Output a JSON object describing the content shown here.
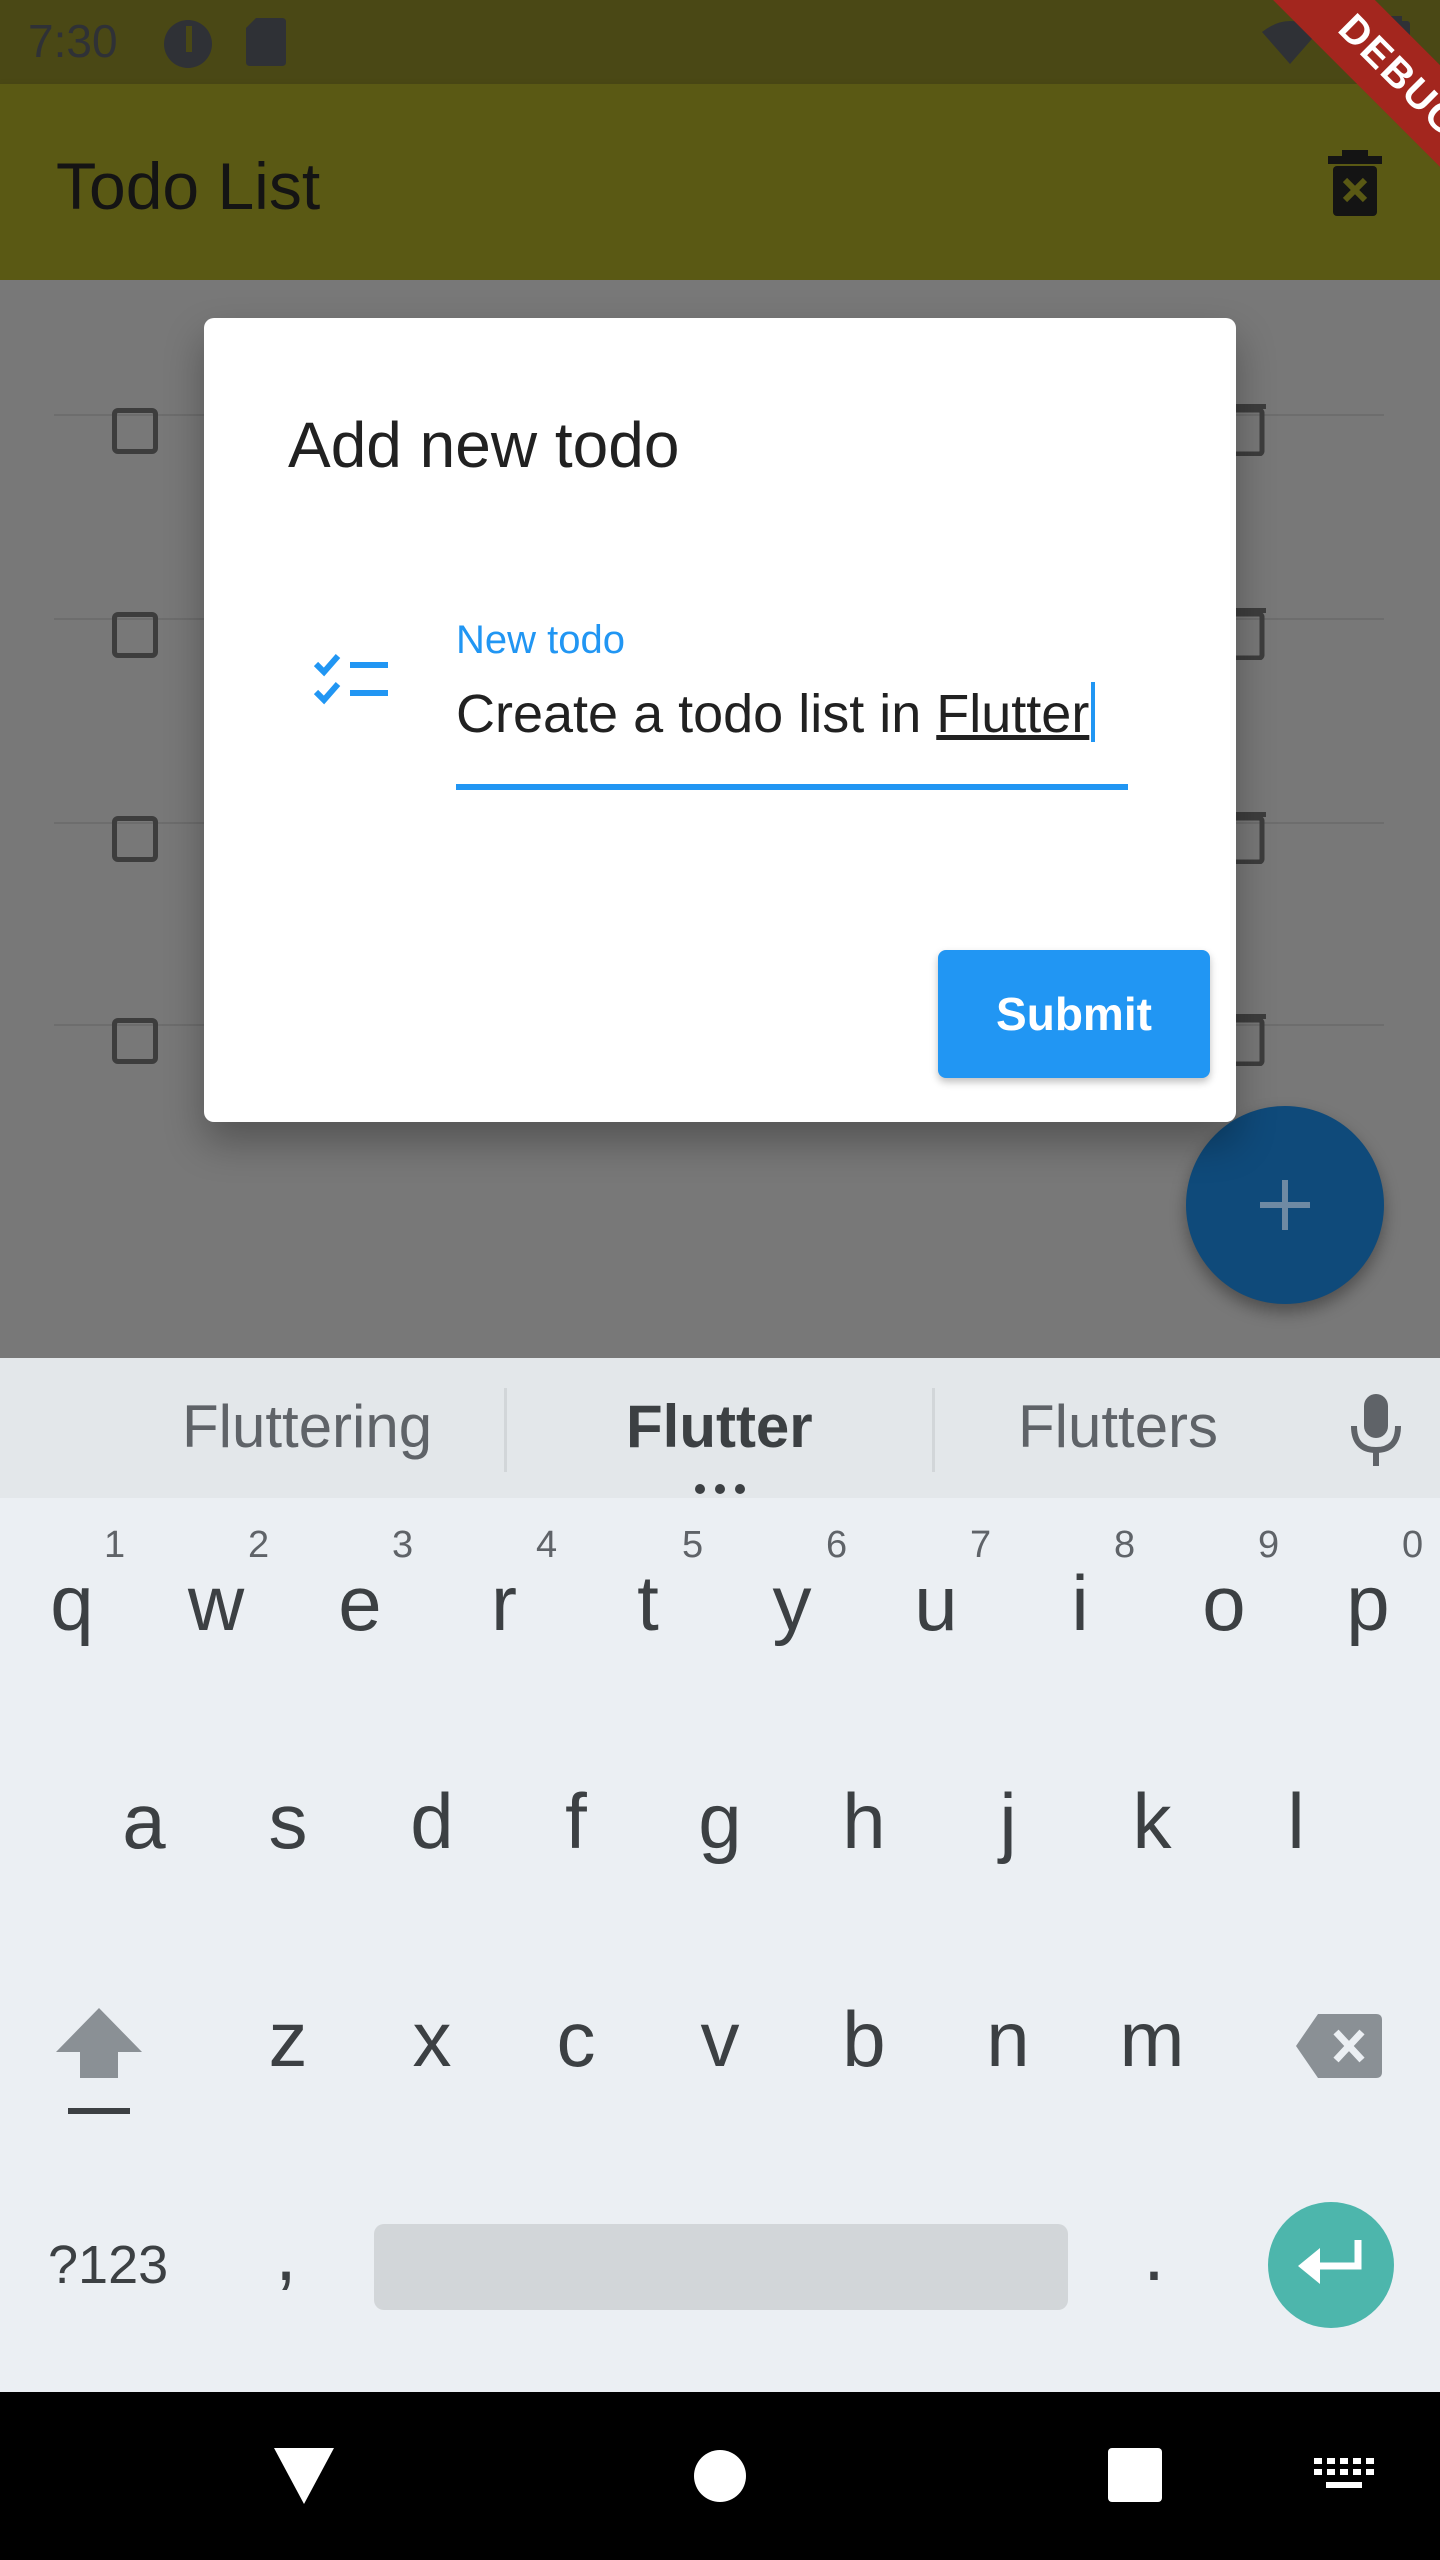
{
  "status_bar": {
    "time": "7:30"
  },
  "app_bar": {
    "title": "Todo List"
  },
  "debug_banner": "DEBUG",
  "dialog": {
    "title": "Add new todo",
    "field_label": "New todo",
    "field_value_prefix": "Create a todo list in ",
    "field_value_word": "Flutter",
    "submit_label": "Submit"
  },
  "keyboard": {
    "suggestions": [
      "Fluttering",
      "Flutter",
      "Flutters"
    ],
    "row1": [
      "q",
      "w",
      "e",
      "r",
      "t",
      "y",
      "u",
      "i",
      "o",
      "p"
    ],
    "row1_hints": [
      "1",
      "2",
      "3",
      "4",
      "5",
      "6",
      "7",
      "8",
      "9",
      "0"
    ],
    "row2": [
      "a",
      "s",
      "d",
      "f",
      "g",
      "h",
      "j",
      "k",
      "l"
    ],
    "row3": [
      "z",
      "x",
      "c",
      "v",
      "b",
      "n",
      "m"
    ],
    "symbols_label": "?123",
    "comma": ",",
    "period": "."
  },
  "colors": {
    "accent": "#2196f3",
    "app_bar": "#5a5914",
    "fab": "#0f4a7a",
    "enter_key": "#4db6ac"
  },
  "icons": [
    "wifi-icon",
    "battery-icon",
    "delete-icon",
    "checklist-icon",
    "add-icon",
    "mic-icon",
    "shift-icon",
    "backspace-icon",
    "enter-icon",
    "nav-back-icon",
    "nav-home-icon",
    "nav-recents-icon",
    "keyboard-icon"
  ]
}
